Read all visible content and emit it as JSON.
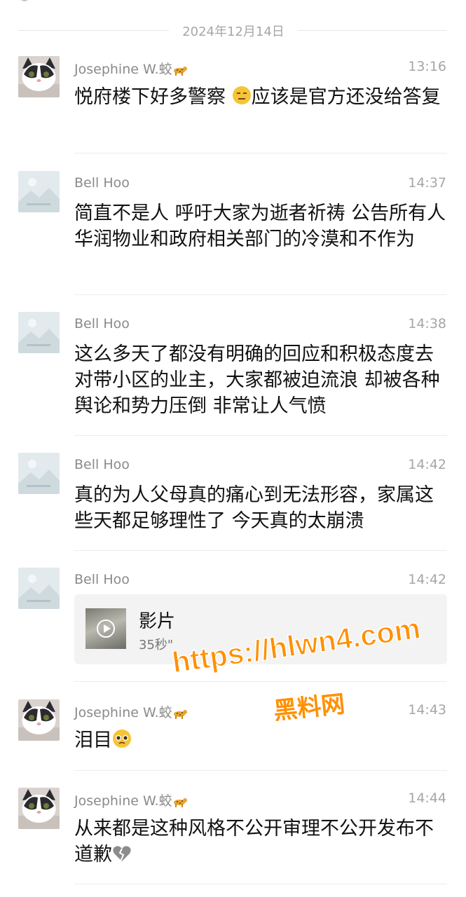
{
  "date_separator": "2024年12月14日",
  "messages": [
    {
      "name": "Josephine W.蛟",
      "time": "13:16",
      "text_a": "悦府楼下好多警察 ",
      "text_b": "应该是官方还没给答复"
    },
    {
      "name": "Bell Hoo",
      "time": "14:37",
      "text": "简直不是人 呼吁大家为逝者祈祷 公告所有人 华润物业和政府相关部门的冷漠和不作为"
    },
    {
      "name": "Bell Hoo",
      "time": "14:38",
      "text": "这么多天了都没有明确的回应和积极态度去对带小区的业主，大家都被迫流浪 却被各种舆论和势力压倒 非常让人气愤"
    },
    {
      "name": "Bell Hoo",
      "time": "14:42",
      "text": "真的为人父母真的痛心到无法形容，家属这些天都足够理性了 今天真的太崩溃"
    },
    {
      "name": "Bell Hoo",
      "time": "14:42",
      "video_title": "影片",
      "video_duration": "35秒\""
    },
    {
      "name": "Josephine W.蛟",
      "time": "14:43",
      "text": "泪目"
    },
    {
      "name": "Josephine W.蛟",
      "time": "14:44",
      "text": "从来都是这种风格不公开审理不公开发布不道歉"
    }
  ],
  "icons": {
    "name_suffix": "leopard-icon",
    "emoji_1": "expressionless-face-icon",
    "emoji_2": "pleading-face-icon",
    "emoji_3": "broken-heart-icon",
    "placeholder_avatar": "image-placeholder-icon"
  },
  "watermark": {
    "url": "https://hlwn4.com",
    "label": "黑料网"
  },
  "colors": {
    "watermark": "#ff9000",
    "name": "#8a8a8a",
    "time": "#a6a6a6",
    "divider": "#ececec"
  }
}
